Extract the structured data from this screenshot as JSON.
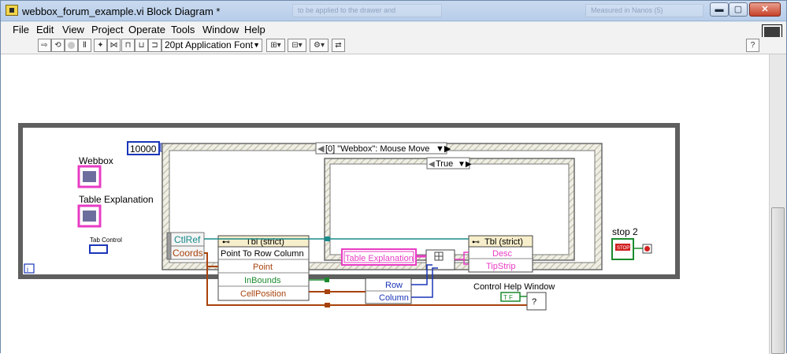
{
  "window": {
    "title": "webbox_forum_example.vi Block Diagram *",
    "ghost_text_1": "to be applied to the drawer and",
    "ghost_text_2": "Measured in Nanos (5)",
    "minimize_label": "▬",
    "maximize_label": "▢",
    "close_label": "✕"
  },
  "menu": {
    "items": [
      {
        "label": "File"
      },
      {
        "label": "Edit"
      },
      {
        "label": "View"
      },
      {
        "label": "Project"
      },
      {
        "label": "Operate"
      },
      {
        "label": "Tools"
      },
      {
        "label": "Window"
      },
      {
        "label": "Help"
      }
    ]
  },
  "toolbar": {
    "font_select": "20pt Application Font",
    "help_glyph": "?"
  },
  "diagram": {
    "timeout_constant": "10000",
    "event_selector": "[0] \"Webbox\": Mouse Move",
    "event_data": {
      "ctlref": "CtlRef",
      "coords": "Coords"
    },
    "invoke_node": {
      "ref": "Tbl (strict)",
      "method": "Point To Row Column",
      "in_point": "Point",
      "out_inbounds": "InBounds",
      "out_cellpos": "CellPosition"
    },
    "case_selector": "True",
    "unbundle": {
      "row": "Row",
      "column": "Column"
    },
    "property_node": {
      "ref": "Tbl (strict)",
      "desc": "Desc",
      "tipstrip": "TipStrip"
    },
    "text_ref": "Table Explanation",
    "help_window_label": "Control Help Window",
    "help_bool": "T F",
    "stop_label": "stop 2",
    "stop_button": "STOP",
    "iteration": "i",
    "webbox_label": "Webbox",
    "table_explanation_label": "Table Explanation",
    "tab_control_label": "Tab Control"
  },
  "colors": {
    "pink": "#e83cc4",
    "orange": "#a8420c",
    "green": "#1b8a2d",
    "blue": "#1a35b8",
    "teal": "#1a8a8a",
    "purple": "#6a2fc2"
  }
}
